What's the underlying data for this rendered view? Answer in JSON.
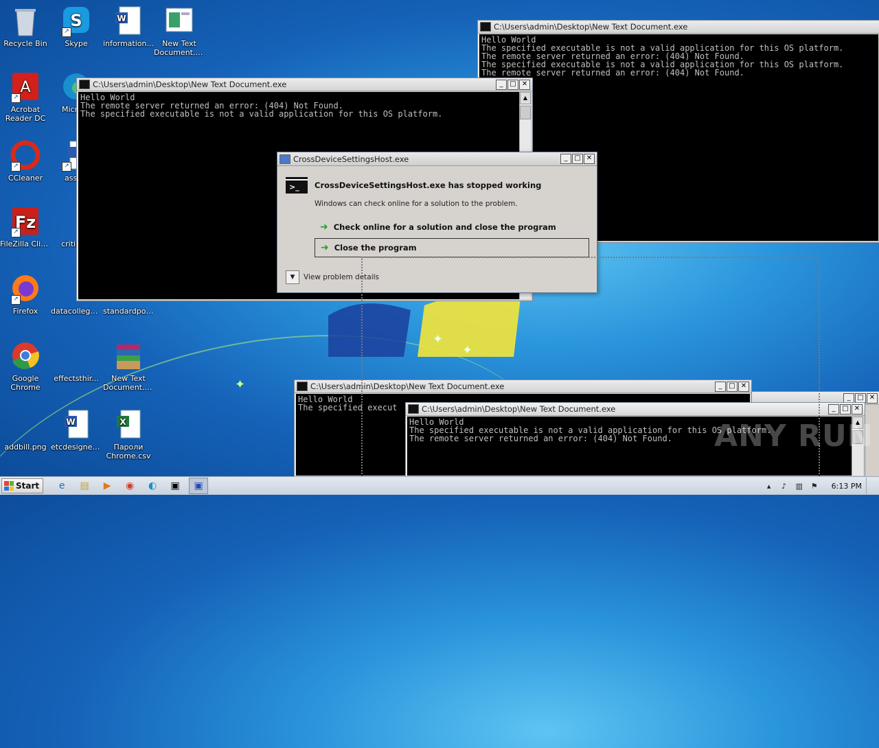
{
  "desktop": {
    "icons": [
      {
        "label": "Recycle Bin",
        "icon": "recycle-bin-icon"
      },
      {
        "label": "Skype",
        "icon": "skype-icon"
      },
      {
        "label": "information...",
        "icon": "word-doc-icon"
      },
      {
        "label": "New Text Document.exe",
        "icon": "exe-icon"
      },
      {
        "label": "Acrobat Reader DC",
        "icon": "acrobat-icon"
      },
      {
        "label": "Microso",
        "icon": "edge-icon"
      },
      {
        "label": "CCleaner",
        "icon": "ccleaner-icon"
      },
      {
        "label": "associ",
        "icon": "word-doc-icon"
      },
      {
        "label": "FileZilla Client",
        "icon": "filezilla-icon"
      },
      {
        "label": "criticaln",
        "icon": "blank-file-icon"
      },
      {
        "label": "Firefox",
        "icon": "firefox-icon"
      },
      {
        "label": "datacollege....",
        "icon": "blank-file-icon"
      },
      {
        "label": "standardpoi...",
        "icon": "blank-file-icon"
      },
      {
        "label": "Google Chrome",
        "icon": "chrome-icon"
      },
      {
        "label": "effectsthir...",
        "icon": "blank-file-icon"
      },
      {
        "label": "New Text Document.b...",
        "icon": "winrar-icon"
      },
      {
        "label": "addbill.png",
        "icon": "blank-file-icon"
      },
      {
        "label": "etcdesigned...",
        "icon": "word-doc-icon"
      },
      {
        "label": "Пароли Chrome.csv",
        "icon": "excel-csv-icon"
      }
    ]
  },
  "windows": {
    "console_top_right": {
      "title": "C:\\Users\\admin\\Desktop\\New Text Document.exe",
      "lines": "Hello World\nThe specified executable is not a valid application for this OS platform.\nThe remote server returned an error: (404) Not Found.\nThe specified executable is not a valid application for this OS platform.\nThe remote server returned an error: (404) Not Found."
    },
    "console_main": {
      "title": "C:\\Users\\admin\\Desktop\\New Text Document.exe",
      "lines": "Hello World\nThe remote server returned an error: (404) Not Found.\nThe specified executable is not a valid application for this OS platform."
    },
    "console_bottom_left": {
      "title": "C:\\Users\\admin\\Desktop\\New Text Document.exe",
      "lines": "Hello World\nThe specified execut"
    },
    "console_bottom_right": {
      "title": "C:\\Users\\admin\\Desktop\\New Text Document.exe",
      "lines": "Hello World\nThe specified executable is not a valid application for this OS platform.\nThe remote server returned an error: (404) Not Found."
    }
  },
  "dialog": {
    "title": "CrossDeviceSettingsHost.exe",
    "heading": "CrossDeviceSettingsHost.exe has stopped working",
    "subtext": "Windows can check online for a solution to the problem.",
    "option_check": "Check online for a solution and close the program",
    "option_close": "Close the program",
    "details": "View problem details"
  },
  "caption_buttons": {
    "min": "_",
    "max": "□",
    "close": "✕"
  },
  "taskbar": {
    "start": "Start",
    "clock": "6:13 PM"
  },
  "watermark": "ANY RUN"
}
